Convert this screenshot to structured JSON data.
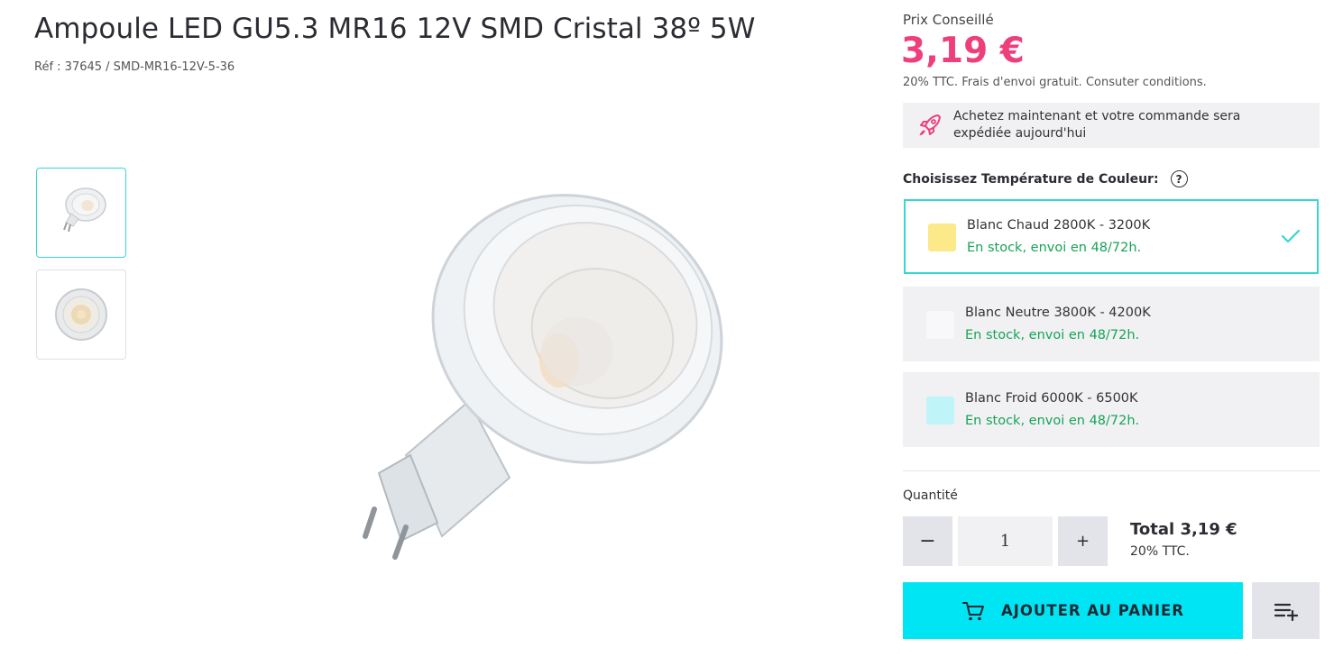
{
  "product": {
    "title": "Ampoule LED GU5.3 MR16 12V SMD Cristal 38º 5W",
    "ref": "Réf : 37645 / SMD-MR16-12V-5-36"
  },
  "pricing": {
    "label": "Prix Conseillé",
    "price": "3,19 €",
    "note": "20% TTC. Frais d'envoi gratuit. Consuter conditions."
  },
  "shipping": {
    "icon": "rocket-icon",
    "text": "Achetez maintenant et votre commande sera expédiée aujourd'hui"
  },
  "color_temperature": {
    "label": "Choisissez Température de Couleur:",
    "help_icon": "?",
    "options": [
      {
        "name": "Blanc Chaud 2800K - 3200K",
        "stock": "En stock, envoi en 48/72h.",
        "swatch": "#fbe98a",
        "selected": true
      },
      {
        "name": "Blanc Neutre 3800K - 4200K",
        "stock": "En stock, envoi en 48/72h.",
        "swatch": "#f8f8fb",
        "selected": false
      },
      {
        "name": "Blanc Froid 6000K - 6500K",
        "stock": "En stock, envoi en 48/72h.",
        "swatch": "#bff4f9",
        "selected": false
      }
    ]
  },
  "quantity": {
    "label": "Quantité",
    "minus": "−",
    "plus": "+",
    "value": "1"
  },
  "total": {
    "text": "Total 3,19 €",
    "note": "20% TTC."
  },
  "actions": {
    "add_to_cart": "AJOUTER AU PANIER",
    "cart_icon": "cart-icon",
    "list_icon": "add-to-list-icon"
  },
  "colors": {
    "accent": "#00e5f4",
    "price": "#ee3f7d",
    "stock": "#16a455",
    "selected_border": "#36d6d6"
  }
}
